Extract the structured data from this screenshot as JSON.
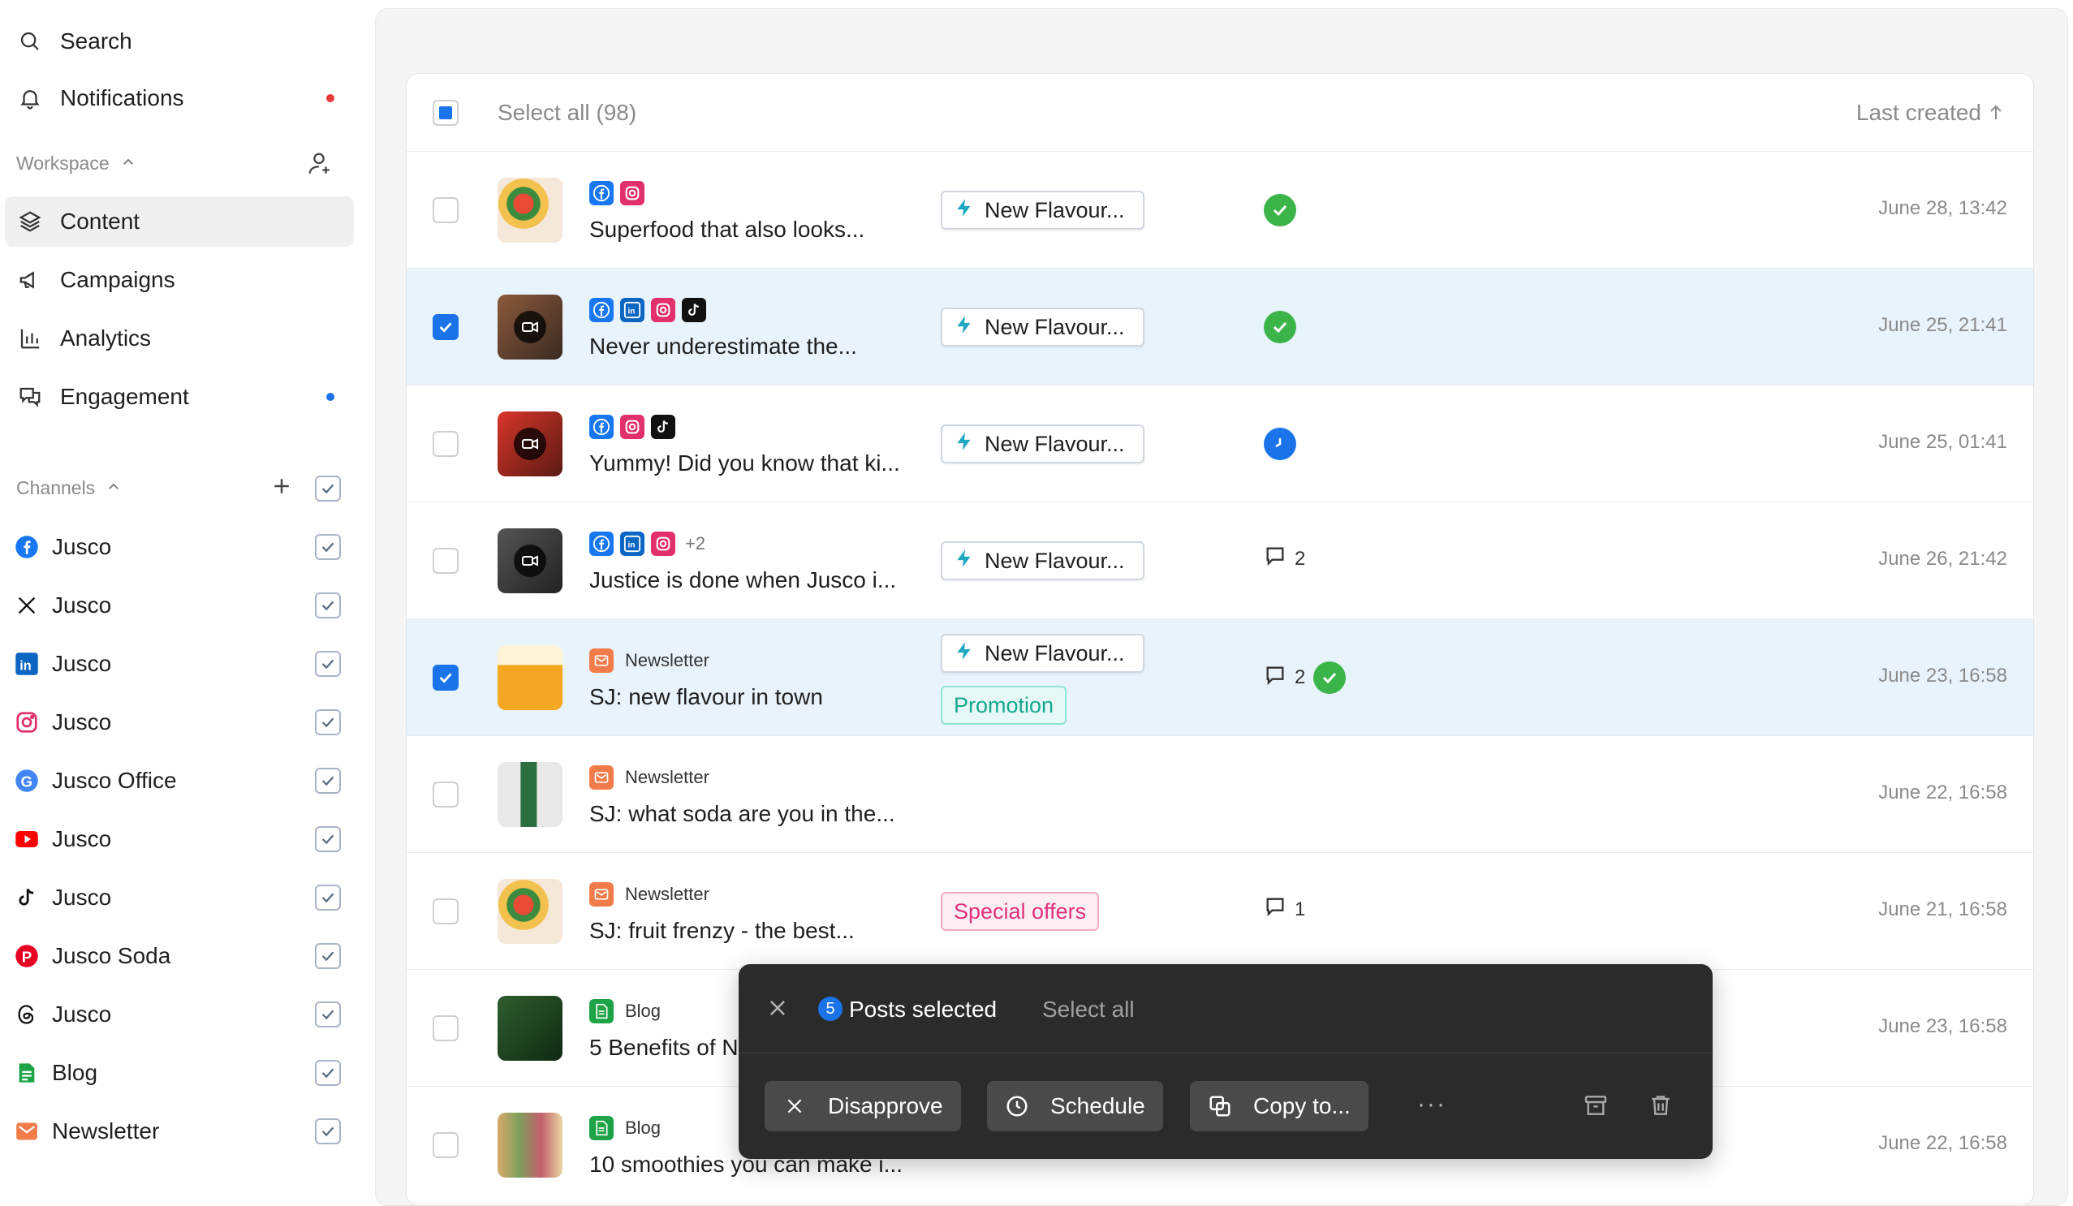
{
  "sidebar": {
    "search": "Search",
    "notifications": "Notifications",
    "workspace_label": "Workspace",
    "nav": [
      {
        "label": "Content"
      },
      {
        "label": "Campaigns"
      },
      {
        "label": "Analytics"
      },
      {
        "label": "Engagement"
      }
    ],
    "channels_label": "Channels",
    "channels": [
      {
        "label": "Jusco",
        "icon": "facebook-icon",
        "color": "#1877f2"
      },
      {
        "label": "Jusco",
        "icon": "x-icon",
        "color": "#111111"
      },
      {
        "label": "Jusco",
        "icon": "linkedin-icon",
        "color": "#0a66c2"
      },
      {
        "label": "Jusco",
        "icon": "instagram-icon",
        "color": "#e1306c"
      },
      {
        "label": "Jusco Office",
        "icon": "google-icon",
        "color": "#4285f4"
      },
      {
        "label": "Jusco",
        "icon": "youtube-icon",
        "color": "#ff0000"
      },
      {
        "label": "Jusco",
        "icon": "tiktok-icon",
        "color": "#111111"
      },
      {
        "label": "Jusco Soda",
        "icon": "pinterest-icon",
        "color": "#e60023"
      },
      {
        "label": "Jusco",
        "icon": "threads-icon",
        "color": "#111111"
      },
      {
        "label": "Blog",
        "icon": "blog-icon",
        "color": "#1ea446"
      },
      {
        "label": "Newsletter",
        "icon": "newsletter-icon",
        "color": "#f27b4a"
      }
    ]
  },
  "table": {
    "select_all": "Select all (98)",
    "sort_label": "Last created",
    "rows": [
      {
        "title": "Superfood that also looks...",
        "tag": "New Flavour...",
        "date": "June 28, 13:42",
        "selected": false
      },
      {
        "title": "Never underestimate the...",
        "tag": "New Flavour...",
        "date": "June 25, 21:41",
        "selected": true
      },
      {
        "title": "Yummy! Did you know that ki...",
        "tag": "New Flavour...",
        "date": "June 25, 01:41",
        "selected": false
      },
      {
        "title": "Justice is done when Jusco i...",
        "tag": "New Flavour...",
        "extra": "+2",
        "comments": "2",
        "date": "June 26, 21:42",
        "selected": false
      },
      {
        "kind": "Newsletter",
        "title": "SJ: new flavour in town",
        "tag": "New Flavour...",
        "tag2": "Promotion",
        "comments": "2",
        "date": "June 23, 16:58",
        "selected": true
      },
      {
        "kind": "Newsletter",
        "title": "SJ: what soda are you in the...",
        "date": "June 22, 16:58",
        "selected": false
      },
      {
        "kind": "Newsletter",
        "title": "SJ: fruit frenzy - the best...",
        "tag2": "Special offers",
        "comments": "1",
        "date": "June 21, 16:58",
        "selected": false
      },
      {
        "kind": "Blog",
        "title": "5 Benefits of N",
        "date": "June 23, 16:58",
        "selected": false
      },
      {
        "kind": "Blog",
        "title": "10 smoothies you can make i...",
        "date": "June 22, 16:58",
        "selected": false
      }
    ]
  },
  "toolbar": {
    "count": "5",
    "selected_label": "Posts selected",
    "select_all": "Select all",
    "disapprove": "Disapprove",
    "schedule": "Schedule",
    "copy": "Copy to...",
    "more": "···"
  }
}
